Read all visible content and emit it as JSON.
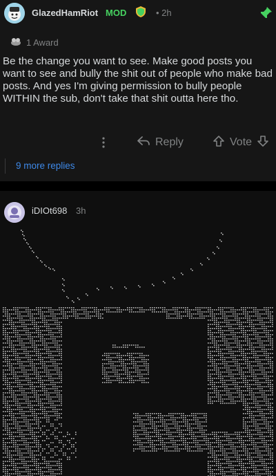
{
  "comment": {
    "username": "GlazedHamRiot",
    "mod_tag": "MOD",
    "time": "• 2h",
    "award_text": "1 Award",
    "body": "Be the change you want to see. Make good posts you want to see and bully the shit out of people who make bad posts. And yes I'm giving permission to bully people WITHIN the sub, don't take that shit outta here tho.",
    "reply_label": "Reply",
    "vote_label": "Vote",
    "more_replies": "9 more replies"
  },
  "reply": {
    "username": "iDIOt698",
    "time": "3h"
  },
  "colors": {
    "background": "#161616",
    "mod_green": "#46d160",
    "link_blue": "#3e89e8",
    "muted": "#818384",
    "text": "#d7dadc"
  },
  "icons": [
    "avatar",
    "mod-shield-icon",
    "pin-icon",
    "award-icon",
    "more-options-icon",
    "reply-arrow-icon",
    "upvote-icon",
    "downvote-icon"
  ]
}
